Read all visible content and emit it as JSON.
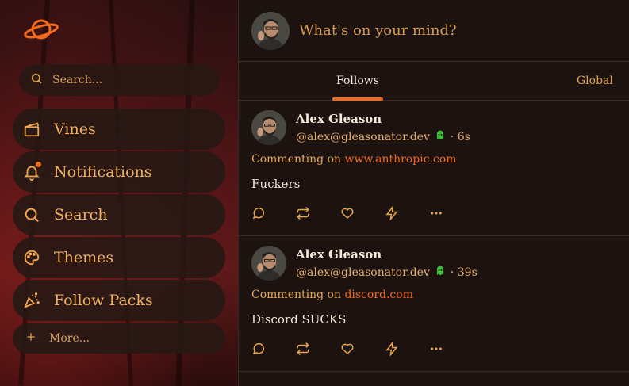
{
  "sidebar": {
    "logo_icon": "planet-icon",
    "search_placeholder": "Search...",
    "items": [
      {
        "label": "Vines",
        "icon": "clapperboard-icon"
      },
      {
        "label": "Notifications",
        "icon": "bell-icon",
        "has_dot": true
      },
      {
        "label": "Search",
        "icon": "search-icon"
      },
      {
        "label": "Themes",
        "icon": "palette-icon"
      },
      {
        "label": "Follow Packs",
        "icon": "party-popper-icon"
      }
    ],
    "more_label": "More..."
  },
  "compose": {
    "placeholder": "What's on your mind?"
  },
  "tabs": [
    {
      "label": "Follows",
      "active": true
    },
    {
      "label": "Global",
      "active": false
    }
  ],
  "posts": [
    {
      "author": "Alex Gleason",
      "handle": "@alex@gleasonator.dev",
      "time": "· 6s",
      "context_prefix": "Commenting on",
      "context_link": "www.anthropic.com",
      "body": "Fuckers"
    },
    {
      "author": "Alex Gleason",
      "handle": "@alex@gleasonator.dev",
      "time": "· 39s",
      "context_prefix": "Commenting on",
      "context_link": "discord.com",
      "body": "Discord SUCKS"
    }
  ],
  "colors": {
    "accent": "#f26b1d",
    "icon": "#f0a64c",
    "nip05": "#3ec23e"
  }
}
